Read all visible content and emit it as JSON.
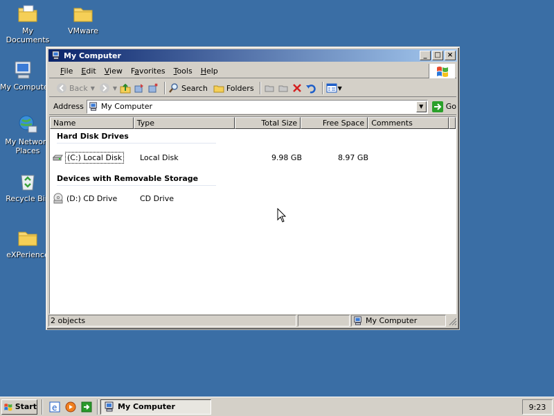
{
  "desktop": {
    "icons": [
      {
        "label": "My Documents",
        "icon": "my-documents-folder-icon"
      },
      {
        "label": "VMware",
        "icon": "folder-icon"
      },
      {
        "label": "My Computer",
        "icon": "my-computer-icon"
      },
      {
        "label": "My Network Places",
        "icon": "network-places-icon"
      },
      {
        "label": "Recycle Bin",
        "icon": "recycle-bin-icon"
      },
      {
        "label": "eXPerience",
        "icon": "folder-icon"
      }
    ]
  },
  "window": {
    "title": "My Computer",
    "menu": [
      "File",
      "Edit",
      "View",
      "Favorites",
      "Tools",
      "Help"
    ],
    "menu_underline": [
      "F",
      "E",
      "V",
      "a",
      "T",
      "H"
    ],
    "toolbar": {
      "back": "Back",
      "search": "Search",
      "folders": "Folders"
    },
    "address": {
      "label": "Address",
      "value": "My Computer",
      "go": "Go"
    },
    "columns": [
      "Name",
      "Type",
      "Total Size",
      "Free Space",
      "Comments"
    ],
    "groups": [
      {
        "title": "Hard Disk Drives",
        "items": [
          {
            "name": "(C:) Local Disk",
            "type": "Local Disk",
            "total": "9.98 GB",
            "free": "8.97 GB"
          }
        ]
      },
      {
        "title": "Devices with Removable Storage",
        "items": [
          {
            "name": "(D:) CD Drive",
            "type": "CD Drive",
            "total": "",
            "free": ""
          }
        ]
      }
    ],
    "status": {
      "objects": "2 objects",
      "location": "My Computer"
    }
  },
  "taskbar": {
    "start": "Start",
    "task": "My Computer",
    "clock": "9:23"
  },
  "colors": {
    "desktop": "#3a6ea5",
    "titlebar_start": "#0a246a",
    "titlebar_end": "#a6caf0",
    "face": "#d4d0c8"
  }
}
